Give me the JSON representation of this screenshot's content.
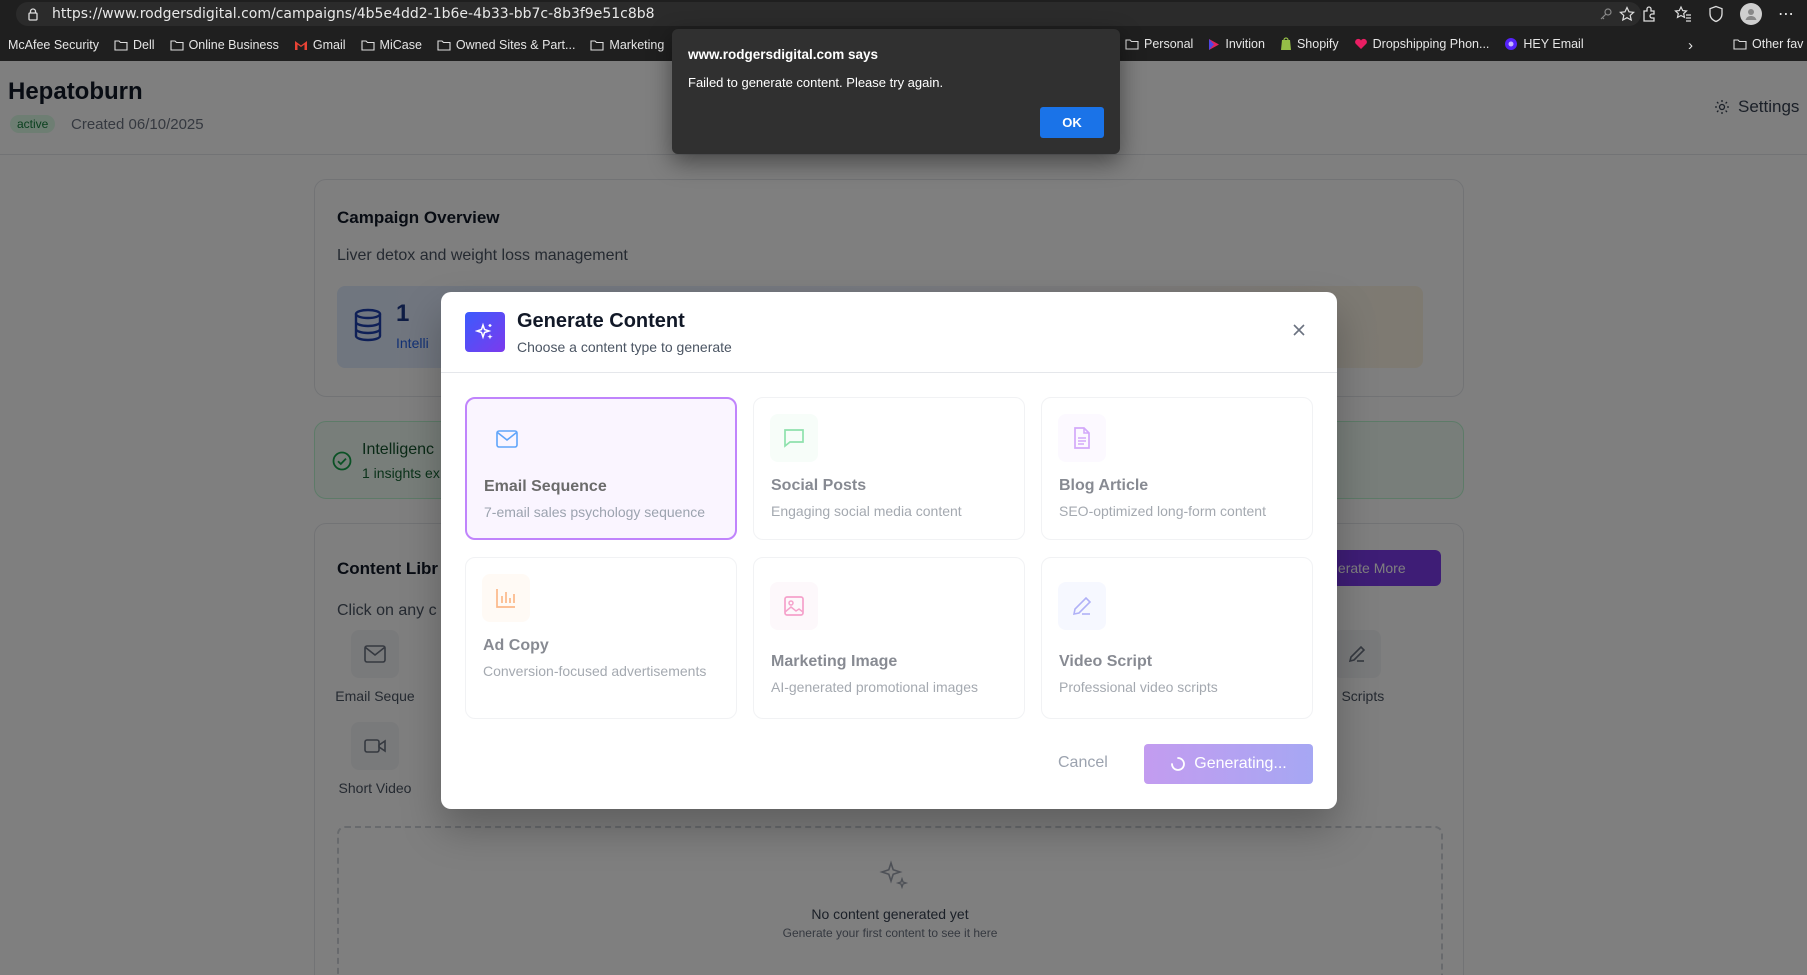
{
  "browser": {
    "url": "https://www.rodgersdigital.com/campaigns/4b5e4dd2-1b6e-4b33-bb7c-8b3f9e51c8b8",
    "bookmarks": [
      {
        "label": "McAfee Security",
        "icon": "none"
      },
      {
        "label": "Dell",
        "icon": "folder-icon"
      },
      {
        "label": "Online Business",
        "icon": "folder-icon"
      },
      {
        "label": "Gmail",
        "icon": "gmail-icon"
      },
      {
        "label": "MiCase",
        "icon": "folder-icon"
      },
      {
        "label": "Owned Sites & Part...",
        "icon": "folder-icon"
      },
      {
        "label": "Marketing",
        "icon": "folder-icon"
      }
    ],
    "bookmarks_right": [
      {
        "label": "Personal",
        "icon": "folder-icon"
      },
      {
        "label": "Invition",
        "icon": "play-icon"
      },
      {
        "label": "Shopify",
        "icon": "shopify-icon"
      },
      {
        "label": "Dropshipping Phon...",
        "icon": "heart-icon"
      },
      {
        "label": "HEY Email",
        "icon": "hey-icon"
      }
    ],
    "other_favorites": "Other fav"
  },
  "header": {
    "title": "Hepatoburn",
    "status": "active",
    "created": "Created 06/10/2025",
    "settings_label": "Settings"
  },
  "overview": {
    "title": "Campaign Overview",
    "description": "Liver detox and weight loss management",
    "stat_value": "1",
    "stat_label": "Intelli"
  },
  "intelligence": {
    "title": "Intelligenc",
    "subtitle": "1 insights ex"
  },
  "library": {
    "title": "Content Libr",
    "hint": "Click on any c",
    "generate_more": "enerate More",
    "types": [
      {
        "label": "Email Seque",
        "icon": "mail-icon"
      },
      {
        "label": "o Scripts",
        "icon": "pen-icon"
      },
      {
        "label": "Short Video",
        "icon": "video-icon"
      }
    ],
    "empty_title": "No content generated yet",
    "empty_sub": "Generate your first content to see it here"
  },
  "modal": {
    "title": "Generate Content",
    "subtitle": "Choose a content type to generate",
    "options": [
      {
        "title": "Email Sequence",
        "desc": "7-email sales psychology sequence",
        "icon": "mail-icon",
        "color": "#3b82f6",
        "bg": "#eff6ff",
        "selected": true
      },
      {
        "title": "Social Posts",
        "desc": "Engaging social media content",
        "icon": "chat-bubble-icon",
        "color": "#22c55e",
        "bg": "#f0fdf4",
        "selected": false
      },
      {
        "title": "Blog Article",
        "desc": "SEO-optimized long-form content",
        "icon": "document-icon",
        "color": "#a855f7",
        "bg": "#faf5ff",
        "selected": false
      },
      {
        "title": "Ad Copy",
        "desc": "Conversion-focused advertisements",
        "icon": "bar-chart-icon",
        "color": "#f97316",
        "bg": "#fff7ed",
        "selected": false
      },
      {
        "title": "Marketing Image",
        "desc": "AI-generated promotional images",
        "icon": "image-icon",
        "color": "#ec4899",
        "bg": "#fdf2f8",
        "selected": false
      },
      {
        "title": "Video Script",
        "desc": "Professional video scripts",
        "icon": "pen-icon",
        "color": "#6366f1",
        "bg": "#eef2ff",
        "selected": false
      }
    ],
    "cancel_label": "Cancel",
    "generate_label": "Generating..."
  },
  "alert": {
    "title": "www.rodgersdigital.com says",
    "message": "Failed to generate content. Please try again.",
    "ok_label": "OK"
  }
}
